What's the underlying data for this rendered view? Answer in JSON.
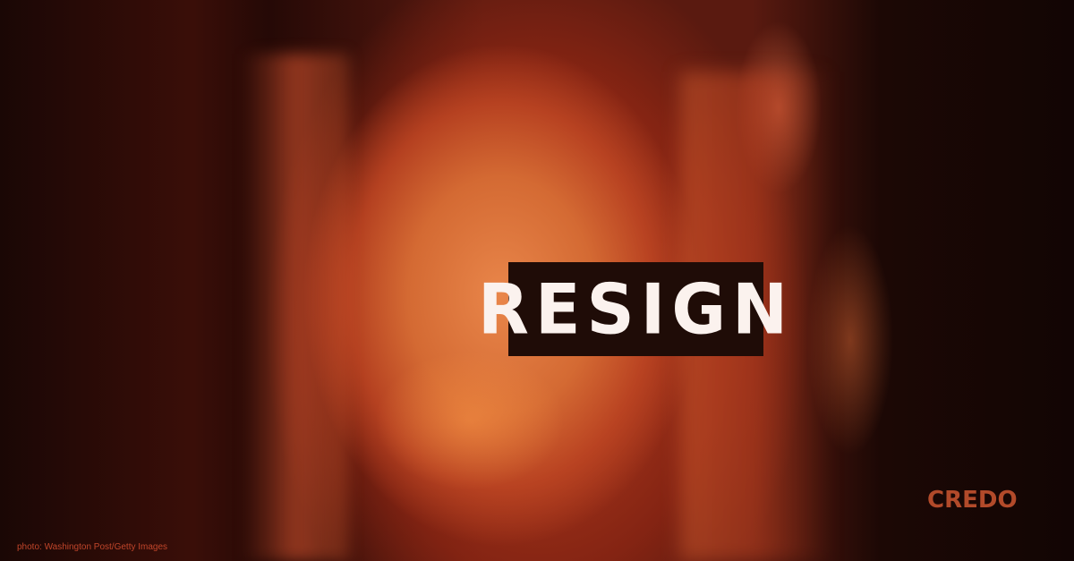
{
  "overlay": {
    "headline": "RESIGN"
  },
  "logo": {
    "text": "CREDO",
    "color": "#b24a2a"
  },
  "credit": {
    "text": "photo:  Washington Post/Getty Images"
  },
  "colors": {
    "tint": "#d46a33",
    "box": "#1f0c07",
    "headline_text": "#fbf2ee"
  }
}
